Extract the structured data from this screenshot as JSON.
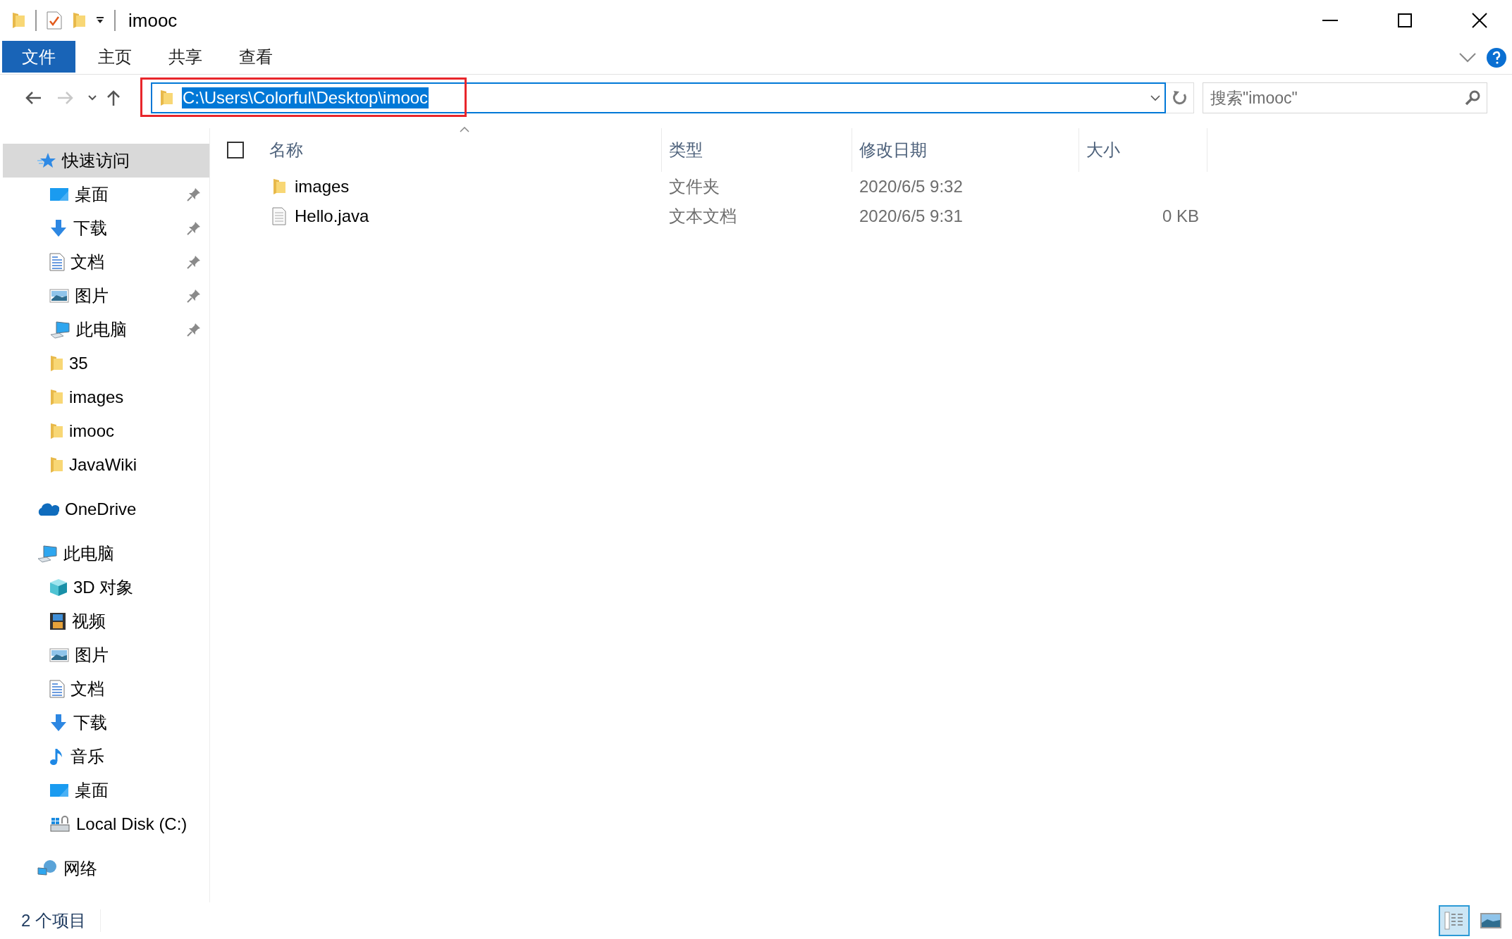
{
  "window": {
    "title": "imooc"
  },
  "ribbon_tabs": [
    {
      "label": "文件",
      "kind": "file"
    },
    {
      "label": "主页",
      "kind": "tab"
    },
    {
      "label": "共享",
      "kind": "tab"
    },
    {
      "label": "查看",
      "kind": "tab"
    }
  ],
  "navigation": {
    "forward_disabled": true
  },
  "address": {
    "value": "C:\\Users\\Colorful\\Desktop\\imooc",
    "text_selected": true,
    "annotated": true
  },
  "search": {
    "placeholder": "搜索\"imooc\""
  },
  "sidebar": {
    "items": [
      {
        "label": "快速访问",
        "kind": "star",
        "selected": true,
        "children": [
          {
            "label": "桌面",
            "kind": "desktop",
            "pinned": true
          },
          {
            "label": "下载",
            "kind": "download",
            "pinned": true
          },
          {
            "label": "文档",
            "kind": "document",
            "pinned": true
          },
          {
            "label": "图片",
            "kind": "picture",
            "pinned": true
          },
          {
            "label": "此电脑",
            "kind": "computer",
            "pinned": true
          },
          {
            "label": "35",
            "kind": "folder",
            "pinned": false
          },
          {
            "label": "images",
            "kind": "folder",
            "pinned": false
          },
          {
            "label": "imooc",
            "kind": "folder",
            "pinned": false
          },
          {
            "label": "JavaWiki",
            "kind": "folder",
            "pinned": false
          }
        ]
      },
      {
        "label": "OneDrive",
        "kind": "cloud",
        "selected": false
      },
      {
        "label": "此电脑",
        "kind": "computer",
        "selected": false,
        "children": [
          {
            "label": "3D 对象",
            "kind": "cube"
          },
          {
            "label": "视频",
            "kind": "video"
          },
          {
            "label": "图片",
            "kind": "picture"
          },
          {
            "label": "文档",
            "kind": "document"
          },
          {
            "label": "下载",
            "kind": "download"
          },
          {
            "label": "音乐",
            "kind": "music"
          },
          {
            "label": "桌面",
            "kind": "desktop"
          },
          {
            "label": "Local Disk (C:)",
            "kind": "disk"
          }
        ]
      },
      {
        "label": "网络",
        "kind": "network",
        "selected": false
      }
    ]
  },
  "table": {
    "select_all_checked": false,
    "columns": [
      "名称",
      "类型",
      "修改日期",
      "大小"
    ],
    "rows": [
      {
        "kind": "folder",
        "name": "images",
        "type": "文件夹",
        "modified": "2020/6/5 9:32"
      },
      {
        "kind": "file",
        "name": "Hello.java",
        "type": "文本文档",
        "modified": "2020/6/5 9:31",
        "size": "0 KB"
      }
    ]
  },
  "status_bar": {
    "count": "2 个项目",
    "views": [
      {
        "kind": "details",
        "selected": true
      },
      {
        "kind": "large-icons",
        "selected": false
      }
    ]
  }
}
